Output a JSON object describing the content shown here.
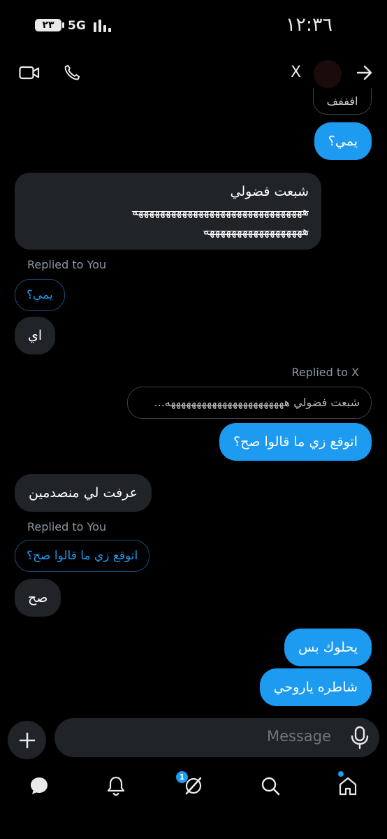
{
  "status_bar": {
    "battery": "٢٣",
    "network": "5G",
    "time": "١٢:٣٦"
  },
  "header": {
    "name": "X"
  },
  "messages": {
    "m0": "افففف",
    "m1": "يمي؟",
    "m2_line1": "شبعت فضولي",
    "m2_line2": "هههههههههههههههههههههههههههههههه",
    "m2_line3": "ههههههههههههههههههه",
    "m3_replied": "Replied to You",
    "m3_quote": "يمي؟",
    "m3_text": "اي",
    "m4_replied": "Replied to X",
    "m4_quote": "شبعت فضولي هههههههههههههههههههههههه...",
    "m4_text": "اتوقع زي ما قالوا صح؟",
    "m5_text": "عرفت لي منصدمين",
    "m6_replied": "Replied to You",
    "m6_quote": "اتوقع زي ما قالوا صح؟",
    "m6_text": "صح",
    "m7_text": "يحلوك بس",
    "m8_text": "شاطره ياروحي"
  },
  "composer": {
    "placeholder": "Message"
  },
  "nav": {
    "notification_count": "1"
  },
  "colors": {
    "accent": "#1d9bf0",
    "received_bubble": "#202327",
    "background": "#000000"
  }
}
